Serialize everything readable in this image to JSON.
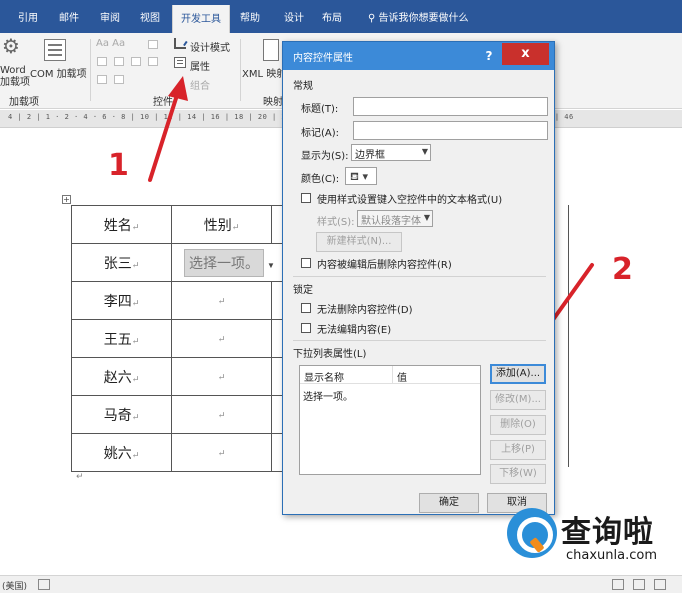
{
  "ribbon_tabs": [
    "引用",
    "邮件",
    "审阅",
    "视图",
    "开发工具",
    "帮助",
    "设计",
    "布局"
  ],
  "tell_me": "告诉我你想要做什么",
  "ribbon": {
    "word_addins": "Word\n加载项",
    "com_addins": "COM 加载项",
    "addins_group": "加载项",
    "design_mode": "设计模式",
    "properties": "属性",
    "group_label": "组合",
    "controls_group": "控件",
    "xml_mapping": "XML 映射",
    "mapping_group": "映射"
  },
  "ruler": "4 | 2 | 1 · 2 · 4 · 6 · 8 | 10 | 12 | 14 | 16 | 18 | 20 | 22 | 24 | 26 | 28 | 30 | 32 | 34 | 36 | 38 | 40 | 42 | 44 | 46",
  "table": {
    "header": [
      "姓名",
      "性别"
    ],
    "rows": [
      "张三",
      "李四",
      "王五",
      "赵六",
      "马奇",
      "姚六"
    ],
    "placeholder": "选择一项。",
    "mark": "↵"
  },
  "annotations": {
    "one": "1",
    "two": "2"
  },
  "dialog": {
    "title": "内容控件属性",
    "help": "?",
    "close": "x",
    "general": "常规",
    "title_label": "标题(T):",
    "tag_label": "标记(A):",
    "show_as_label": "显示为(S):",
    "show_as_value": "边界框",
    "color_label": "颜色(C):",
    "use_style": "使用样式设置键入空控件中的文本格式(U)",
    "style_label": "样式(S):",
    "style_value": "默认段落字体",
    "new_style": "新建样式(N)...",
    "remove_when_edited": "内容被编辑后删除内容控件(R)",
    "locking": "锁定",
    "cannot_delete": "无法删除内容控件(D)",
    "cannot_edit": "无法编辑内容(E)",
    "dropdown_props": "下拉列表属性(L)",
    "col_display": "显示名称",
    "col_value": "值",
    "list_item": "选择一项。",
    "add": "添加(A)...",
    "modify": "修改(M)...",
    "remove": "删除(O)",
    "move_up": "上移(P)",
    "move_down": "下移(W)",
    "ok": "确定",
    "cancel": "取消"
  },
  "watermark": {
    "title": "查询啦",
    "domain": "chaxunla.com"
  },
  "status": {
    "language": "(美国)"
  },
  "colors": {
    "ribbon_blue": "#2b579a",
    "dialog_blue": "#3c8ad8",
    "close_red": "#c9302c",
    "arrow_red": "#d8232a"
  }
}
